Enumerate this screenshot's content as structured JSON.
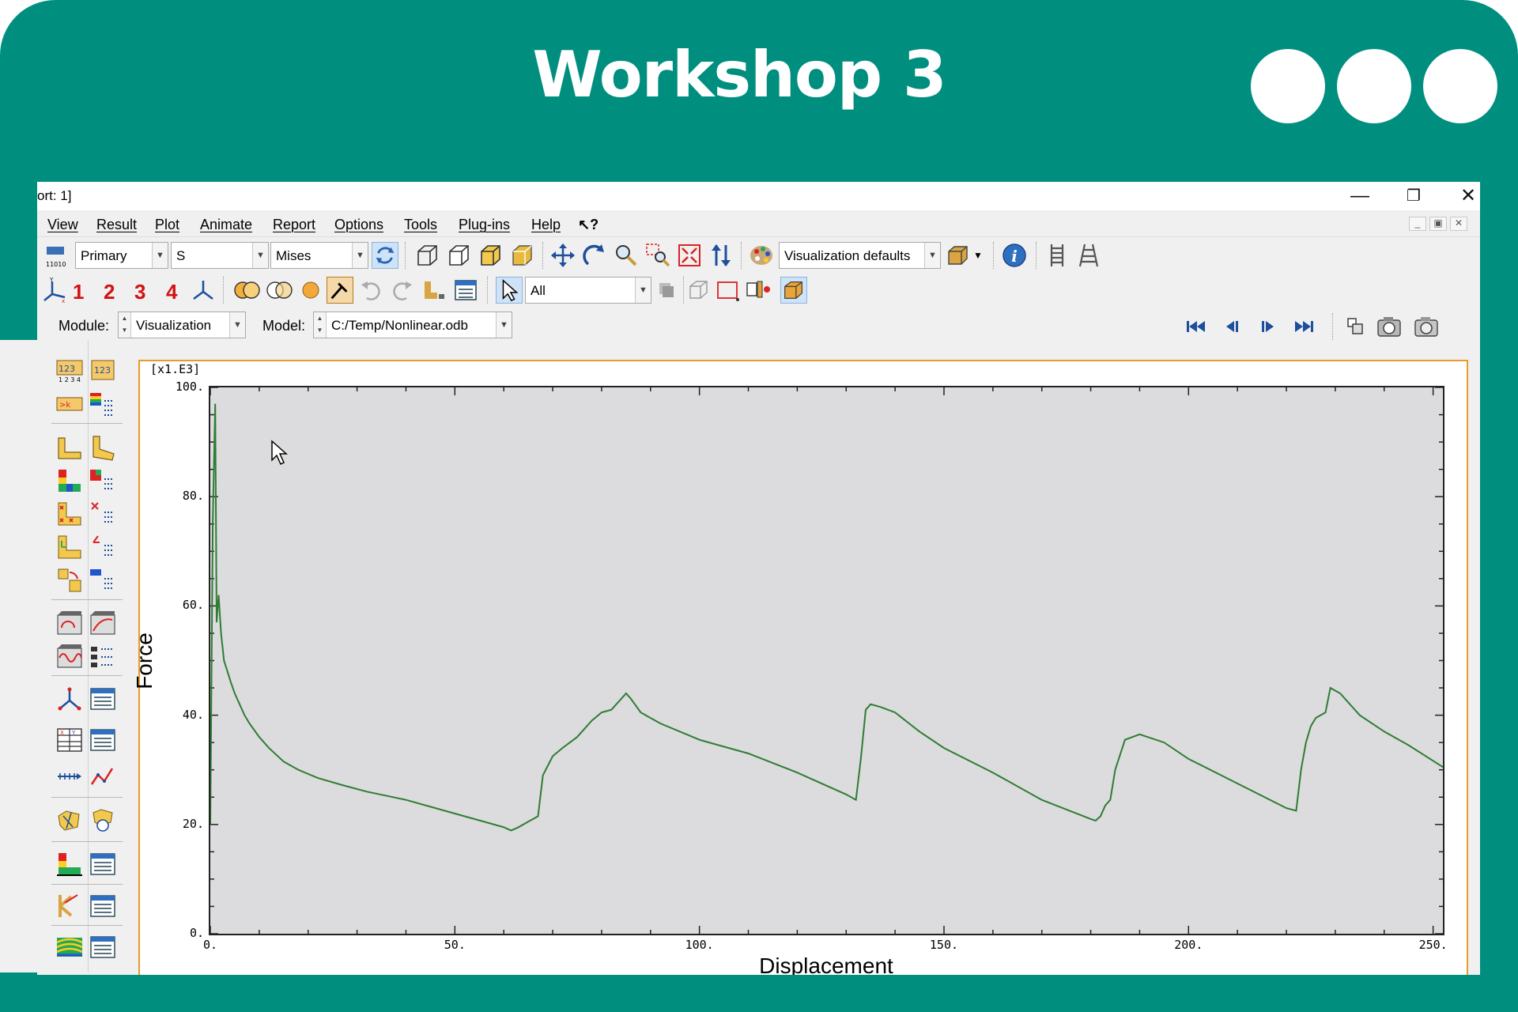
{
  "banner": {
    "title": "Workshop 3"
  },
  "window": {
    "title_fragment": "ort: 1]",
    "minimize_icon": "minimize-icon",
    "maximize_icon": "restore-icon",
    "close_icon": "close-icon"
  },
  "menu": {
    "items": [
      "View",
      "Result",
      "Plot",
      "Animate",
      "Report",
      "Options",
      "Tools",
      "Plug-ins",
      "Help"
    ],
    "context_help": "↖?"
  },
  "toolbar1": {
    "step_field": "Primary",
    "variable": "S",
    "invariant": "Mises",
    "visualization_defaults": "Visualization defaults"
  },
  "toolbar2": {
    "numbers": [
      "1",
      "2",
      "3",
      "4"
    ],
    "selection_filter": "All"
  },
  "context_bar": {
    "module_label": "Module:",
    "module_value": "Visualization",
    "model_label": "Model:",
    "model_value": "C:/Temp/Nonlinear.odb"
  },
  "colors": {
    "banner": "#008f7f",
    "curve": "#2e7d32",
    "viewport_border": "#e89a2a",
    "plot_bg": "#dcdbde"
  },
  "chart_data": {
    "type": "line",
    "xlabel": "Displacement",
    "ylabel": "Force",
    "y_scale_note": "[x1.E3]",
    "xlim": [
      0,
      252
    ],
    "ylim": [
      0,
      100
    ],
    "x_ticks": [
      "0.",
      "50.",
      "100.",
      "150.",
      "200.",
      "250."
    ],
    "y_ticks": [
      "0.",
      "20.",
      "40.",
      "60.",
      "80.",
      "100."
    ],
    "grid": false,
    "series": [
      {
        "x": [
          0,
          0.5,
          1,
          1.3,
          1.7,
          2.2,
          2.8,
          3.5,
          4.2,
          5,
          6,
          7,
          8,
          10,
          12,
          15,
          18,
          22,
          27,
          32,
          40,
          50,
          60,
          61.5,
          63,
          65,
          66,
          67,
          68,
          70,
          72,
          75,
          78,
          80,
          82,
          84,
          85,
          86,
          88,
          92,
          100,
          110,
          120,
          130,
          132,
          133,
          134,
          135,
          137,
          140,
          145,
          150,
          160,
          170,
          180,
          181,
          182,
          183,
          184,
          185,
          187,
          190,
          195,
          200,
          210,
          220,
          222,
          223,
          224,
          225,
          226,
          227,
          228,
          229,
          231,
          235,
          240,
          245,
          252
        ],
        "y": [
          20,
          75,
          97,
          57,
          62,
          55,
          50,
          48,
          46,
          44,
          42,
          40,
          38.5,
          36,
          34,
          31.5,
          30,
          28.5,
          27.2,
          26,
          24.5,
          22,
          19.5,
          18.9,
          19.5,
          20.5,
          21,
          21.5,
          29,
          32.5,
          34,
          36,
          39,
          40.5,
          41,
          43,
          44,
          43,
          40.5,
          38.5,
          35.5,
          33,
          29.5,
          25.5,
          24.5,
          32,
          41,
          42,
          41.5,
          40.5,
          37,
          34,
          29.5,
          24.5,
          21,
          20.7,
          21.5,
          23.5,
          24.5,
          30,
          35.5,
          36.5,
          35,
          32,
          27.5,
          23,
          22.5,
          30,
          35,
          38,
          39.5,
          40,
          40.5,
          45,
          44,
          40,
          37,
          34.5,
          30.5
        ]
      }
    ]
  }
}
